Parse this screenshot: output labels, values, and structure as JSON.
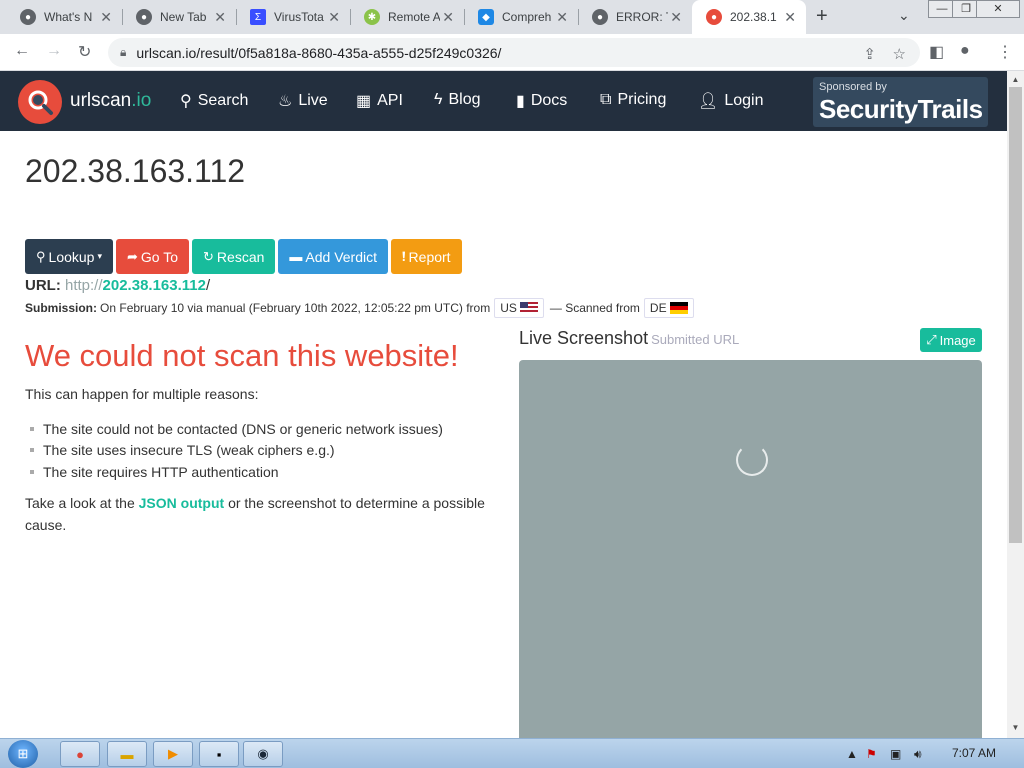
{
  "browser": {
    "tabs": [
      {
        "title": "What's N",
        "active": false
      },
      {
        "title": "New Tab",
        "active": false
      },
      {
        "title": "VirusTota",
        "active": false
      },
      {
        "title": "Remote A",
        "active": false
      },
      {
        "title": "Compreh",
        "active": false
      },
      {
        "title": "ERROR: T",
        "active": false
      },
      {
        "title": "202.38.1",
        "active": true
      }
    ],
    "new_tab_icon": "+",
    "url": "urlscan.io/result/0f5a818a-8680-435a-a555-d25f249c0326/"
  },
  "site_nav": {
    "brand_main": "urlscan",
    "brand_suffix": ".io",
    "items": [
      {
        "label": "Search",
        "icon": "search-icon"
      },
      {
        "label": "Live",
        "icon": "fire-icon"
      },
      {
        "label": "API",
        "icon": "qrcode-icon"
      },
      {
        "label": "Blog",
        "icon": "bolt-icon"
      },
      {
        "label": "Docs",
        "icon": "bookmark-icon"
      },
      {
        "label": "Pricing",
        "icon": "external-link-icon"
      },
      {
        "label": "Login",
        "icon": "user-icon"
      }
    ],
    "sponsor_by": "Sponsored by",
    "sponsor_name": "SecurityTrails"
  },
  "result": {
    "title": "202.38.163.112",
    "buttons": {
      "lookup": "Lookup",
      "goto": "Go To",
      "rescan": "Rescan",
      "add_verdict": "Add Verdict",
      "report": "Report"
    },
    "url_label": "URL:",
    "url_proto": "http://",
    "url_host": "202.38.163.112",
    "url_tail": "/",
    "submission_label": "Submission:",
    "submission_text": "On February 10 via manual (February 10th 2022, 12:05:22 pm UTC) from",
    "submitted_country": "US",
    "scanned_from_label": "— Scanned from",
    "scanned_country": "DE",
    "error_title": "We could not scan this website!",
    "reasons_intro": "This can happen for multiple reasons:",
    "reasons": [
      "The site could not be contacted (DNS or generic network issues)",
      "The site uses insecure TLS (weak ciphers e.g.)",
      "The site requires HTTP authentication"
    ],
    "take_look_prefix": "Take a look at the",
    "json_link": "JSON output",
    "take_look_suffix": "or the screenshot to determine a possible cause.",
    "live_screenshot_title": "Live Screenshot",
    "live_screenshot_sub": "Submitted URL",
    "image_button": "Image"
  },
  "taskbar": {
    "clock": "7:07 AM"
  },
  "colors": {
    "nav_bg": "#232f3e",
    "danger": "#e74c3c",
    "success": "#18bc9c",
    "info": "#3498db",
    "warning": "#f39c12",
    "screenshot_bg": "#95a5a6"
  }
}
